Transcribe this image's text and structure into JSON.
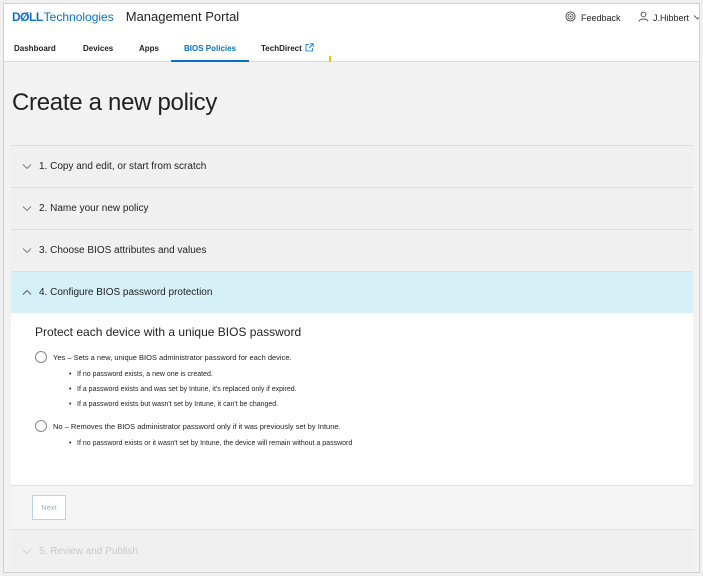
{
  "header": {
    "brand_dell": "DØLL",
    "brand_tech": "Technologies",
    "portal_title": "Management Portal",
    "feedback_label": "Feedback",
    "user_name": "J.Hibbert"
  },
  "tabs": [
    {
      "label": "Dashboard"
    },
    {
      "label": "Devices"
    },
    {
      "label": "Apps"
    },
    {
      "label": "BIOS Policies"
    },
    {
      "label": "TechDirect"
    }
  ],
  "page": {
    "title": "Create a new policy"
  },
  "steps": [
    {
      "label": "1. Copy and edit, or start from scratch"
    },
    {
      "label": "2. Name your new policy"
    },
    {
      "label": "3. Choose BIOS attributes and values"
    },
    {
      "label": "4. Configure BIOS password protection"
    },
    {
      "label": "5. Review and Publish"
    }
  ],
  "password_section": {
    "heading": "Protect each device with a unique BIOS password",
    "yes_option": {
      "label": "Yes – Sets a new, unique BIOS administrator password for each device.",
      "bullets": [
        "If no password exists, a new one is created.",
        "If a password exists and was set by Intune, it's replaced only if expired.",
        "If a password exists but wasn't set by Intune, it can't be changed."
      ]
    },
    "no_option": {
      "label": "No – Removes the BIOS administrator password only if it was previously set by Intune.",
      "bullets": [
        "If no password exists or it wasn't set by Intune, the device will remain without a password"
      ]
    }
  },
  "actions": {
    "next_label": "Next"
  },
  "colors": {
    "accent": "#0672cb",
    "active_step_bg": "#d6f0f8",
    "marker": "#f2c500"
  }
}
